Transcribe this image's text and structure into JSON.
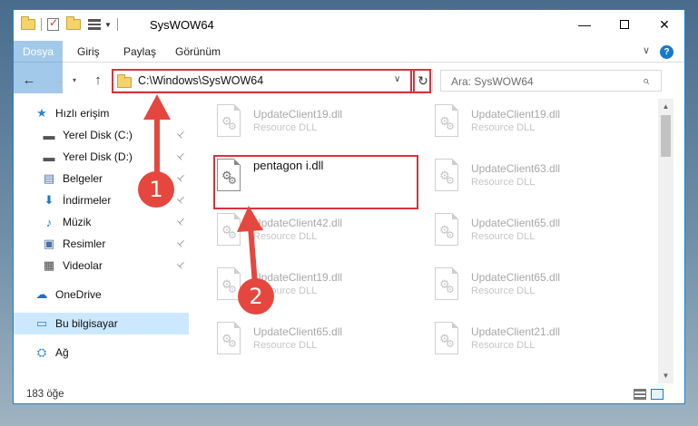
{
  "window": {
    "title": "SysWOW64",
    "controls": {
      "minimize": "—",
      "maximize": "",
      "close": "✕"
    }
  },
  "ribbon": {
    "tabs": [
      "Dosya",
      "Giriş",
      "Paylaş",
      "Görünüm"
    ],
    "help": "?"
  },
  "nav": {
    "back": "←",
    "forward": "→",
    "recent": "▾",
    "up": "↑",
    "address": "C:\\Windows\\SysWOW64",
    "address_dropdown": "∨",
    "refresh": "↻",
    "search_placeholder": "Ara: SysWOW64",
    "search_icon": "⌕"
  },
  "sidebar": {
    "items": [
      {
        "label": "Hızlı erişim",
        "icon": "star-icon",
        "glyph": "★",
        "color": "#2f7fd1"
      },
      {
        "label": "Yerel Disk (C:)",
        "icon": "drive-icon",
        "glyph": "▬",
        "color": "#555555",
        "pinned": true
      },
      {
        "label": "Yerel Disk (D:)",
        "icon": "drive-icon",
        "glyph": "▬",
        "color": "#555555",
        "pinned": true
      },
      {
        "label": "Belgeler",
        "icon": "document-icon",
        "glyph": "▤",
        "color": "#4a6fa5",
        "pinned": true
      },
      {
        "label": "İndirmeler",
        "icon": "download-icon",
        "glyph": "⬇",
        "color": "#1979ca",
        "pinned": true
      },
      {
        "label": "Müzik",
        "icon": "music-icon",
        "glyph": "♪",
        "color": "#1979ca",
        "pinned": true
      },
      {
        "label": "Resimler",
        "icon": "pictures-icon",
        "glyph": "▣",
        "color": "#4a6fa5",
        "pinned": true
      },
      {
        "label": "Videolar",
        "icon": "video-icon",
        "glyph": "▦",
        "color": "#444444",
        "pinned": true
      },
      {
        "label": "OneDrive",
        "icon": "cloud-icon",
        "glyph": "☁",
        "color": "#1f6fc5"
      },
      {
        "label": "Bu bilgisayar",
        "icon": "computer-icon",
        "glyph": "▭",
        "color": "#2f7fd1",
        "selected": true
      },
      {
        "label": "Ağ",
        "icon": "network-icon",
        "glyph": "⛭",
        "color": "#2f7fd1"
      }
    ],
    "pin_glyph": "📌"
  },
  "files": [
    {
      "name": "UpdateClient19.dll",
      "desc": "Resource DLL"
    },
    {
      "name": "UpdateClient19.dll",
      "desc": "Resource DLL"
    },
    {
      "name": "pentagon i.dll",
      "desc": "",
      "active": true
    },
    {
      "name": "UpdateClient63.dll",
      "desc": "Resource DLL"
    },
    {
      "name": "UpdateClient42.dll",
      "desc": "Resource DLL"
    },
    {
      "name": "UpdateClient65.dll",
      "desc": "Resource DLL"
    },
    {
      "name": "UpdateClient19.dll",
      "desc": "Resource DLL"
    },
    {
      "name": "UpdateClient65.dll",
      "desc": "Resource DLL"
    },
    {
      "name": "UpdateClient65.dll",
      "desc": "Resource DLL"
    },
    {
      "name": "UpdateClient21.dll",
      "desc": "Resource DLL"
    }
  ],
  "status": {
    "item_count": "183 öğe"
  },
  "annotations": {
    "step1": "1",
    "step2": "2",
    "color": "#e5473f"
  }
}
